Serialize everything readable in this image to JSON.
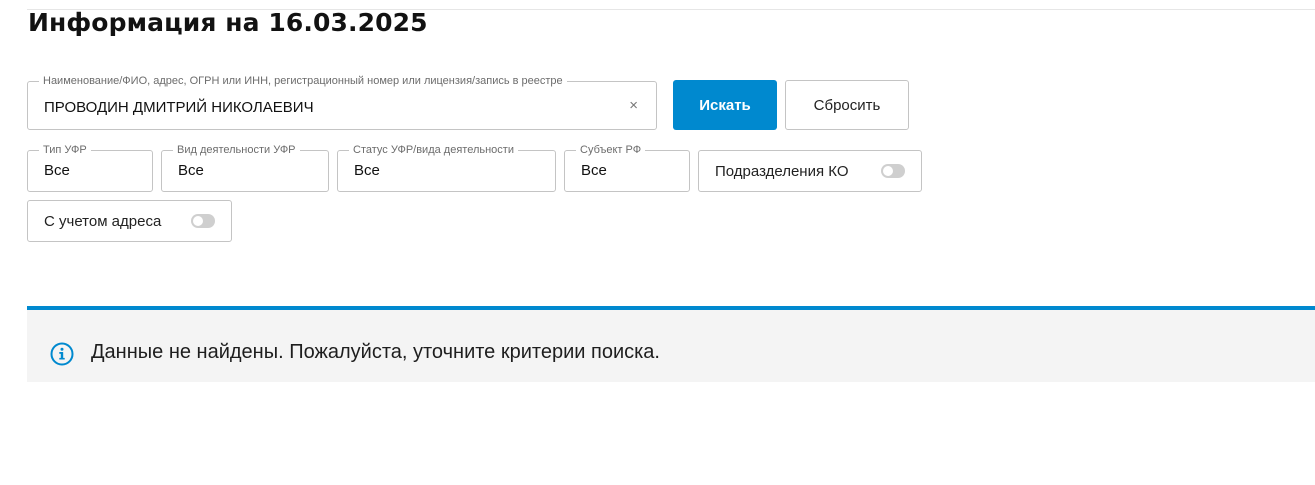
{
  "page": {
    "title": "Информация на 16.03.2025"
  },
  "search": {
    "label": "Наименование/ФИО, адрес, ОГРН или ИНН, регистрационный номер или лицензия/запись в реестре",
    "value": "ПРОВОДИН ДМИТРИЙ НИКОЛАЕВИЧ",
    "clear_glyph": "×",
    "search_button": "Искать",
    "reset_button": "Сбросить"
  },
  "filters": {
    "type": {
      "label": "Тип УФР",
      "value": "Все"
    },
    "activity": {
      "label": "Вид деятельности УФР",
      "value": "Все"
    },
    "status": {
      "label": "Статус УФР/вида деятельности",
      "value": "Все"
    },
    "subject": {
      "label": "Субъект РФ",
      "value": "Все"
    }
  },
  "toggles": {
    "ko_divisions": {
      "label": "Подразделения КО",
      "enabled": false
    },
    "with_address": {
      "label": "С учетом адреса",
      "enabled": false
    }
  },
  "notice": {
    "icon": "info-icon",
    "text": "Данные не найдены. Пожалуйста, уточните критерии поиска."
  },
  "colors": {
    "accent": "#0089cf",
    "notice_bg": "#f4f4f4",
    "border": "#c4c4c4"
  }
}
